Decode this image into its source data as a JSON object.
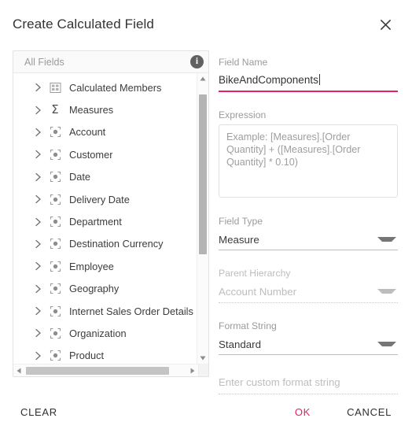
{
  "dialog": {
    "title": "Create Calculated Field",
    "close_icon": "close-icon"
  },
  "tree": {
    "header_label": "All Fields",
    "info_icon": "info-icon",
    "info_glyph": "i",
    "items": [
      {
        "label": "Calculated Members",
        "icon": "calculated-members-icon"
      },
      {
        "label": "Measures",
        "icon": "sigma-icon"
      },
      {
        "label": "Account",
        "icon": "dimension-icon"
      },
      {
        "label": "Customer",
        "icon": "dimension-icon"
      },
      {
        "label": "Date",
        "icon": "dimension-icon"
      },
      {
        "label": "Delivery Date",
        "icon": "dimension-icon"
      },
      {
        "label": "Department",
        "icon": "dimension-icon"
      },
      {
        "label": "Destination Currency",
        "icon": "dimension-icon"
      },
      {
        "label": "Employee",
        "icon": "dimension-icon"
      },
      {
        "label": "Geography",
        "icon": "dimension-icon"
      },
      {
        "label": "Internet Sales Order Details",
        "icon": "dimension-icon"
      },
      {
        "label": "Organization",
        "icon": "dimension-icon"
      },
      {
        "label": "Product",
        "icon": "dimension-icon"
      }
    ]
  },
  "form": {
    "field_name": {
      "label": "Field Name",
      "value": "BikeAndComponents"
    },
    "expression": {
      "label": "Expression",
      "value": "",
      "placeholder": "Example: [Measures].[Order Quantity] + ([Measures].[Order Quantity] * 0.10)"
    },
    "field_type": {
      "label": "Field Type",
      "value": "Measure"
    },
    "parent_hierarchy": {
      "label": "Parent Hierarchy",
      "value": "Account Number",
      "disabled": true
    },
    "format_string": {
      "label": "Format String",
      "value": "Standard"
    },
    "custom_format": {
      "value": "",
      "placeholder": "Enter custom format string",
      "disabled": true
    }
  },
  "footer": {
    "clear_label": "CLEAR",
    "ok_label": "OK",
    "cancel_label": "CANCEL"
  },
  "colors": {
    "accent": "#e91e63",
    "text": "#333333",
    "muted": "#9b9b9b",
    "disabled": "#bdbdbd",
    "border": "#e3e3e3"
  }
}
